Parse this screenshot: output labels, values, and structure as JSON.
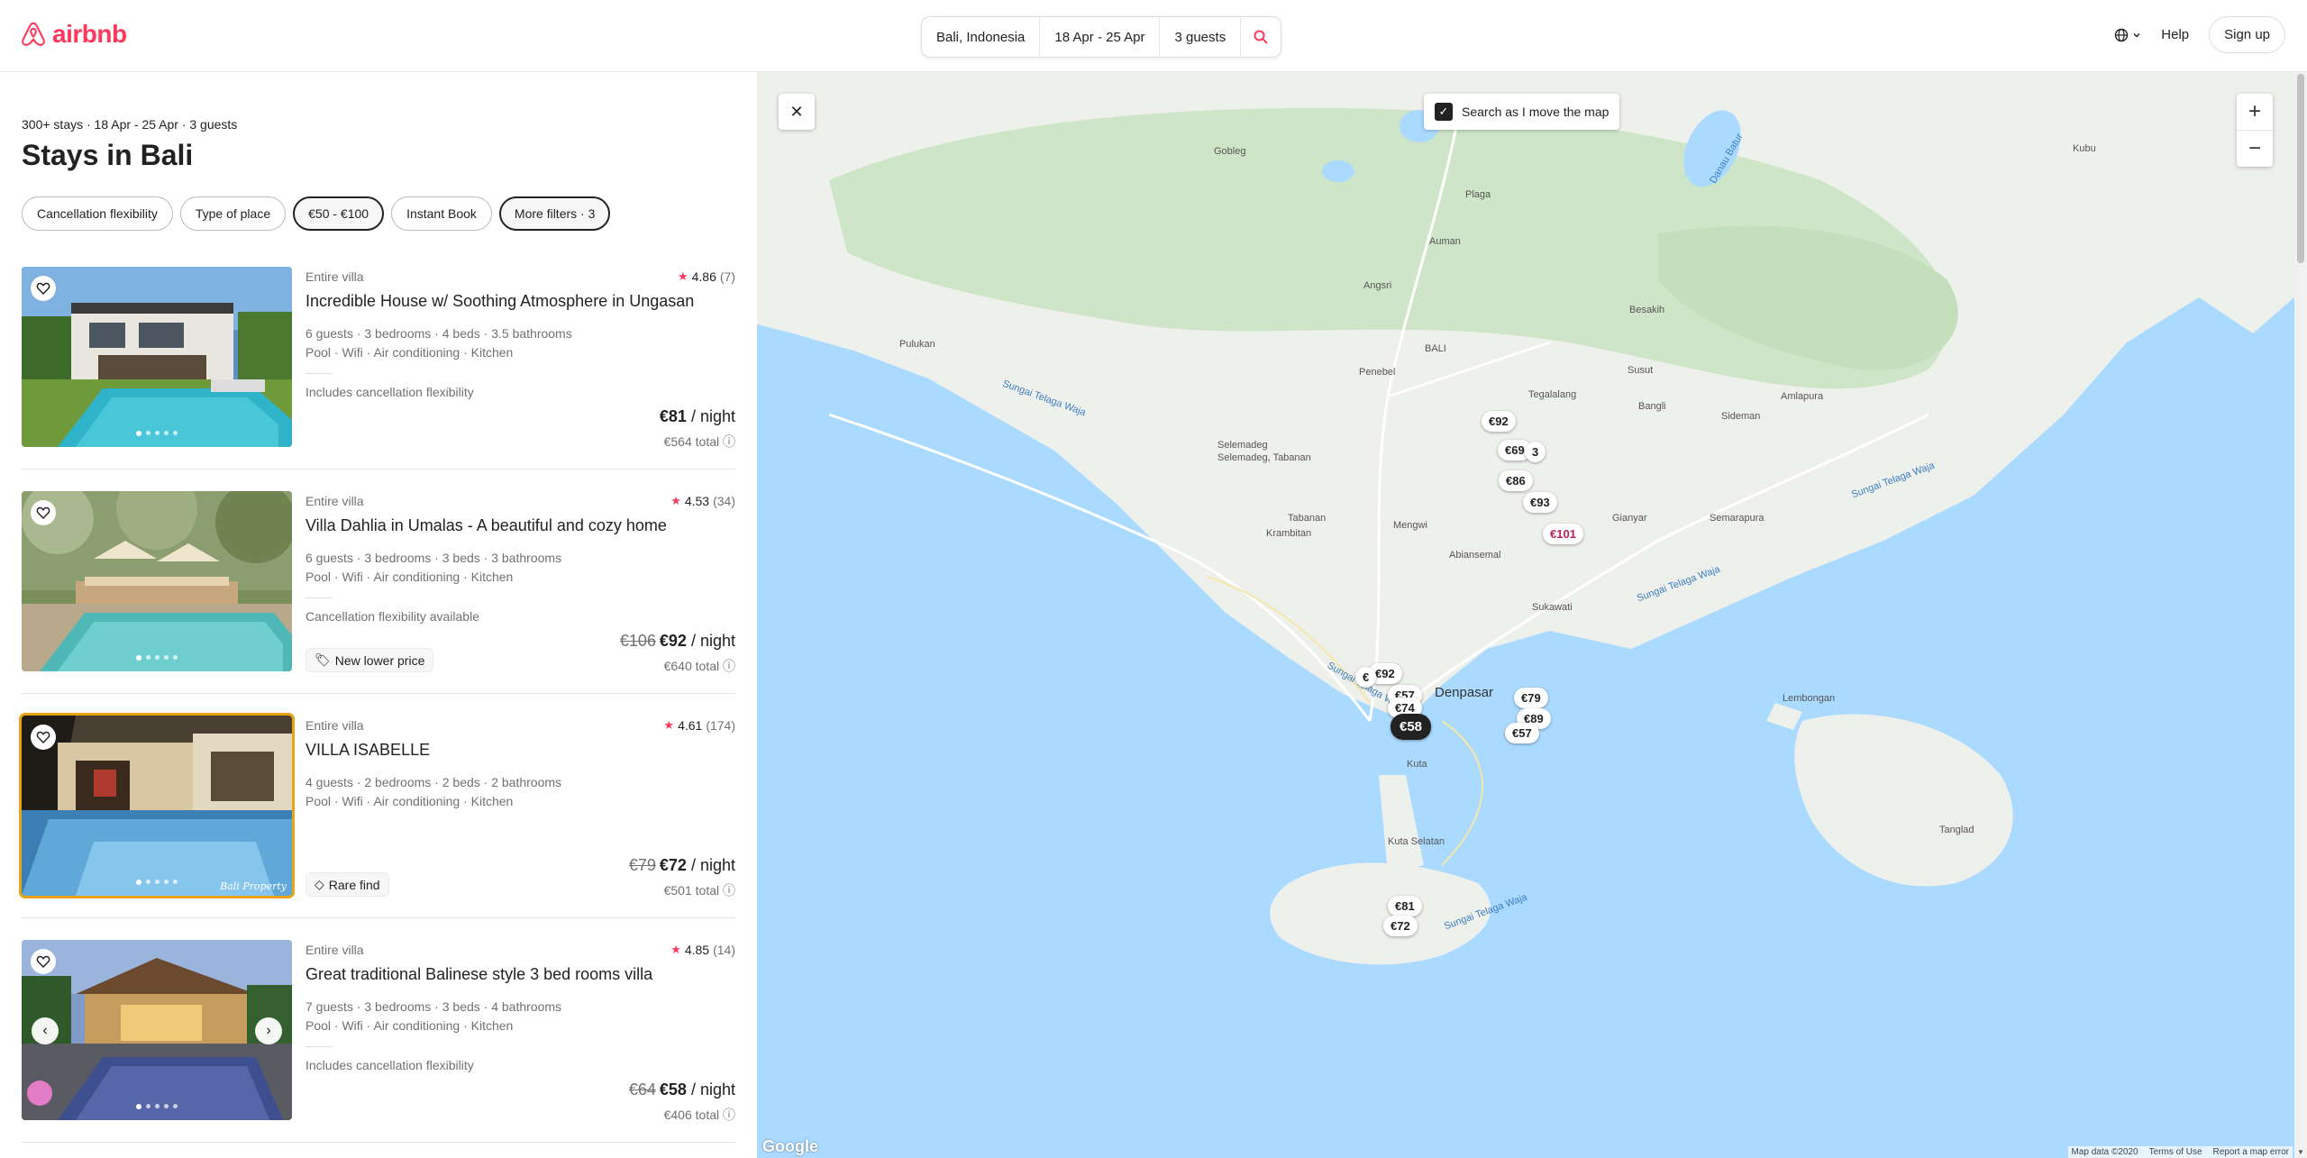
{
  "header": {
    "logo_text": "airbnb",
    "search": {
      "location": "Bali, Indonesia",
      "dates": "18 Apr - 25 Apr",
      "guests": "3 guests"
    },
    "help": "Help",
    "signup": "Sign up"
  },
  "results": {
    "summary": "300+ stays · 18 Apr - 25 Apr · 3 guests",
    "title": "Stays in Bali",
    "filters": [
      "Cancellation flexibility",
      "Type of place",
      "€50 - €100",
      "Instant Book",
      "More filters · 3"
    ]
  },
  "listings": [
    {
      "type": "Entire villa",
      "rating": "4.86",
      "reviews": "(7)",
      "title": "Incredible House w/ Soothing Atmosphere in Ungasan",
      "details": "6 guests · 3 bedrooms · 4 beds · 3.5 bathrooms",
      "amenities": "Pool · Wifi · Air conditioning · Kitchen",
      "cancellation": "Includes cancellation flexibility",
      "badge": "",
      "old_price": "",
      "price": "€81",
      "per": " / night",
      "total": "€564 total"
    },
    {
      "type": "Entire villa",
      "rating": "4.53",
      "reviews": "(34)",
      "title": "Villa Dahlia in Umalas - A beautiful and cozy home",
      "details": "6 guests · 3 bedrooms · 3 beds · 3 bathrooms",
      "amenities": "Pool · Wifi · Air conditioning · Kitchen",
      "cancellation": "Cancellation flexibility available",
      "badge": "New lower price",
      "old_price": "€106",
      "price": "€92",
      "per": " / night",
      "total": "€640 total"
    },
    {
      "type": "Entire villa",
      "rating": "4.61",
      "reviews": "(174)",
      "title": "VILLA ISABELLE",
      "details": "4 guests · 2 bedrooms · 2 beds · 2 bathrooms",
      "amenities": "Pool · Wifi · Air conditioning · Kitchen",
      "cancellation": "",
      "badge": "Rare find",
      "old_price": "€79",
      "price": "€72",
      "per": " / night",
      "total": "€501 total",
      "watermark": "Bali Property"
    },
    {
      "type": "Entire villa",
      "rating": "4.85",
      "reviews": "(14)",
      "title": "Great traditional Balinese style 3 bed rooms villa",
      "details": "7 guests · 3 bedrooms · 3 beds · 4 bathrooms",
      "amenities": "Pool · Wifi · Air conditioning · Kitchen",
      "cancellation": "Includes cancellation flexibility",
      "badge": "",
      "old_price": "€64",
      "price": "€58",
      "per": " / night",
      "total": "€406 total"
    }
  ],
  "map": {
    "search_as_move": "Search as I move the map",
    "zoom_in": "+",
    "zoom_out": "−",
    "pins": [
      "€92",
      "€69",
      "3",
      "€86",
      "€93",
      "€101",
      "€92",
      "€",
      "€57",
      "€74",
      "€58",
      "€79",
      "€89",
      "€57",
      "€81",
      "€72"
    ],
    "places": [
      "Gobleg",
      "Plaga",
      "Auman",
      "Angsri",
      "BALI",
      "Besakih",
      "Pulukan",
      "Penebel",
      "Susut",
      "Tegalalang",
      "Bangli",
      "Sideman",
      "Amlapura",
      "Kubu",
      "Danau Batur",
      "Selemadeg",
      "Selemadeg, Tabanan",
      "Tabanan",
      "Krambitan",
      "Mengwi",
      "Abiansemal",
      "Gianyar",
      "Semarapura",
      "Sukawati",
      "Denpasar",
      "Kuta",
      "Kuta Selatan",
      "Lembongan",
      "Tanglad",
      "Sungai Telaga Waja",
      "Sungai Telaga Waja",
      "Sungai Telaga Waja",
      "Sungai Telaga Waja",
      "Sungai Telaga Waja"
    ],
    "attribution": "Google",
    "footer": [
      "Map data ©2020",
      "Terms of Use",
      "Report a map error"
    ],
    "colors": {
      "water": "#aadaff",
      "land": "#eef0eb",
      "forest": "#cfe5c7",
      "price_pin_accent": "#c01f61"
    }
  },
  "colors": {
    "brand": "#ff385c",
    "text": "#222222",
    "muted": "#717171"
  }
}
